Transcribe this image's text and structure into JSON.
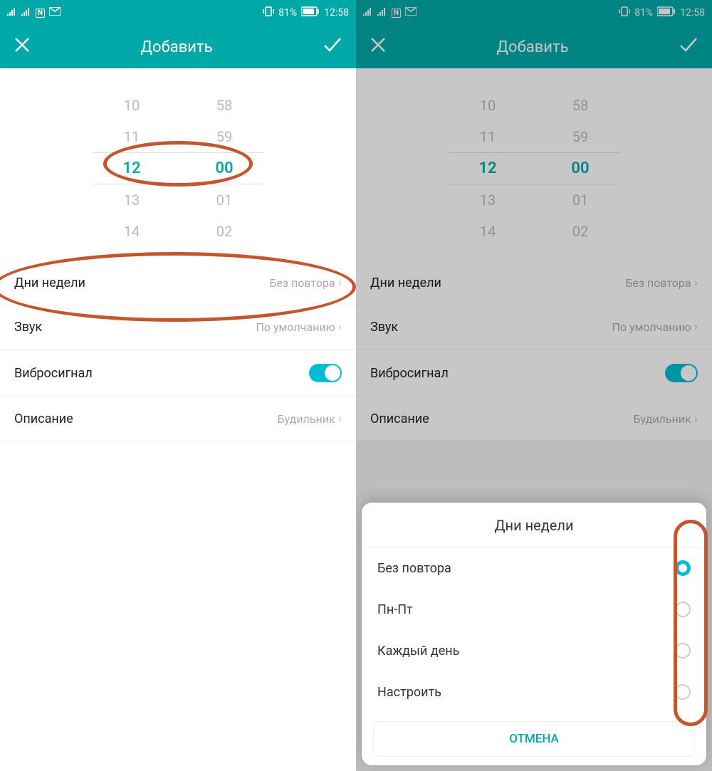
{
  "status": {
    "battery_pct": "81%",
    "time": "12:58"
  },
  "header": {
    "title": "Добавить"
  },
  "time_picker": {
    "hours": [
      "10",
      "11",
      "12",
      "13",
      "14"
    ],
    "minutes": [
      "58",
      "59",
      "00",
      "01",
      "02"
    ],
    "selected_index": 2
  },
  "settings": {
    "days": {
      "label": "Дни недели",
      "value": "Без повтора"
    },
    "sound": {
      "label": "Звук",
      "value": "По умолчанию"
    },
    "vibrate": {
      "label": "Вибросигнал",
      "on": true
    },
    "description": {
      "label": "Описание",
      "value": "Будильник"
    }
  },
  "sheet": {
    "title": "Дни недели",
    "options": [
      {
        "label": "Без повтора",
        "selected": true
      },
      {
        "label": "Пн-Пт",
        "selected": false
      },
      {
        "label": "Каждый день",
        "selected": false
      },
      {
        "label": "Настроить",
        "selected": false
      }
    ],
    "cancel": "ОТМЕНА"
  }
}
